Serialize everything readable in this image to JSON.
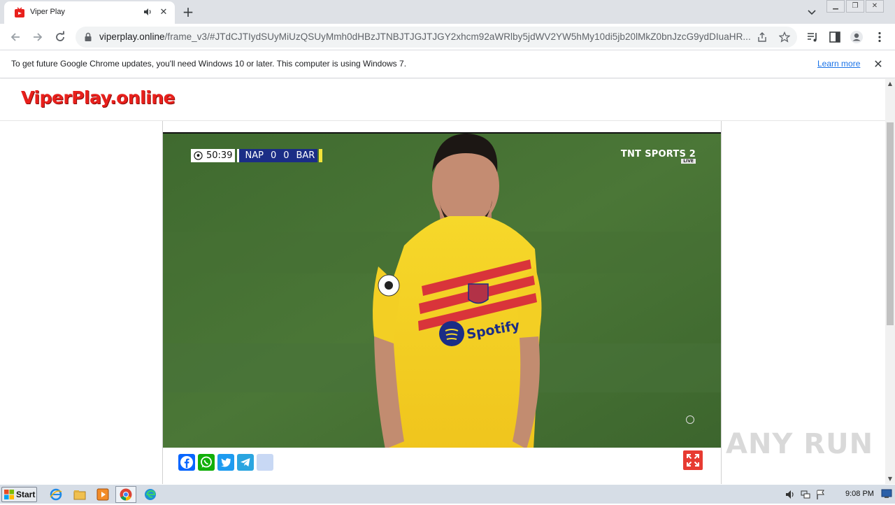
{
  "browser": {
    "tab_title": "Viper Play",
    "url_host": "viperplay.online",
    "url_path": "/frame_v3/#JTdCJTIydSUyMiUzQSUyMmh0dHBzJTNBJTJGJTJGY2xhcm92aWRlby5jdWV2YW5hMy10di5jb20lMkZ0bnJzcG9ydDIuaHR...",
    "accent_color": "#1a73e8"
  },
  "infobar": {
    "message": "To get future Google Chrome updates, you'll need Windows 10 or later. This computer is using Windows 7.",
    "link_label": "Learn more"
  },
  "site": {
    "logo_text": "ViperPlay.online",
    "logo_color": "#e8201c"
  },
  "video": {
    "scorebug": {
      "clock": "50:39",
      "home_team": "NAP",
      "home_score": "0",
      "away_score": "0",
      "away_team": "BAR"
    },
    "broadcaster": "SPORTS 2",
    "broadcaster_prefix": "TNT",
    "live_tag": "LIVE",
    "shirt_sponsor": "Spotify"
  },
  "share": {
    "buttons": [
      "facebook-icon",
      "whatsapp-icon",
      "twitter-icon",
      "telegram-icon",
      "more-share-icon"
    ]
  },
  "watermark": "ANY RUN",
  "taskbar": {
    "start_label": "Start",
    "clock": "9:08 PM"
  }
}
